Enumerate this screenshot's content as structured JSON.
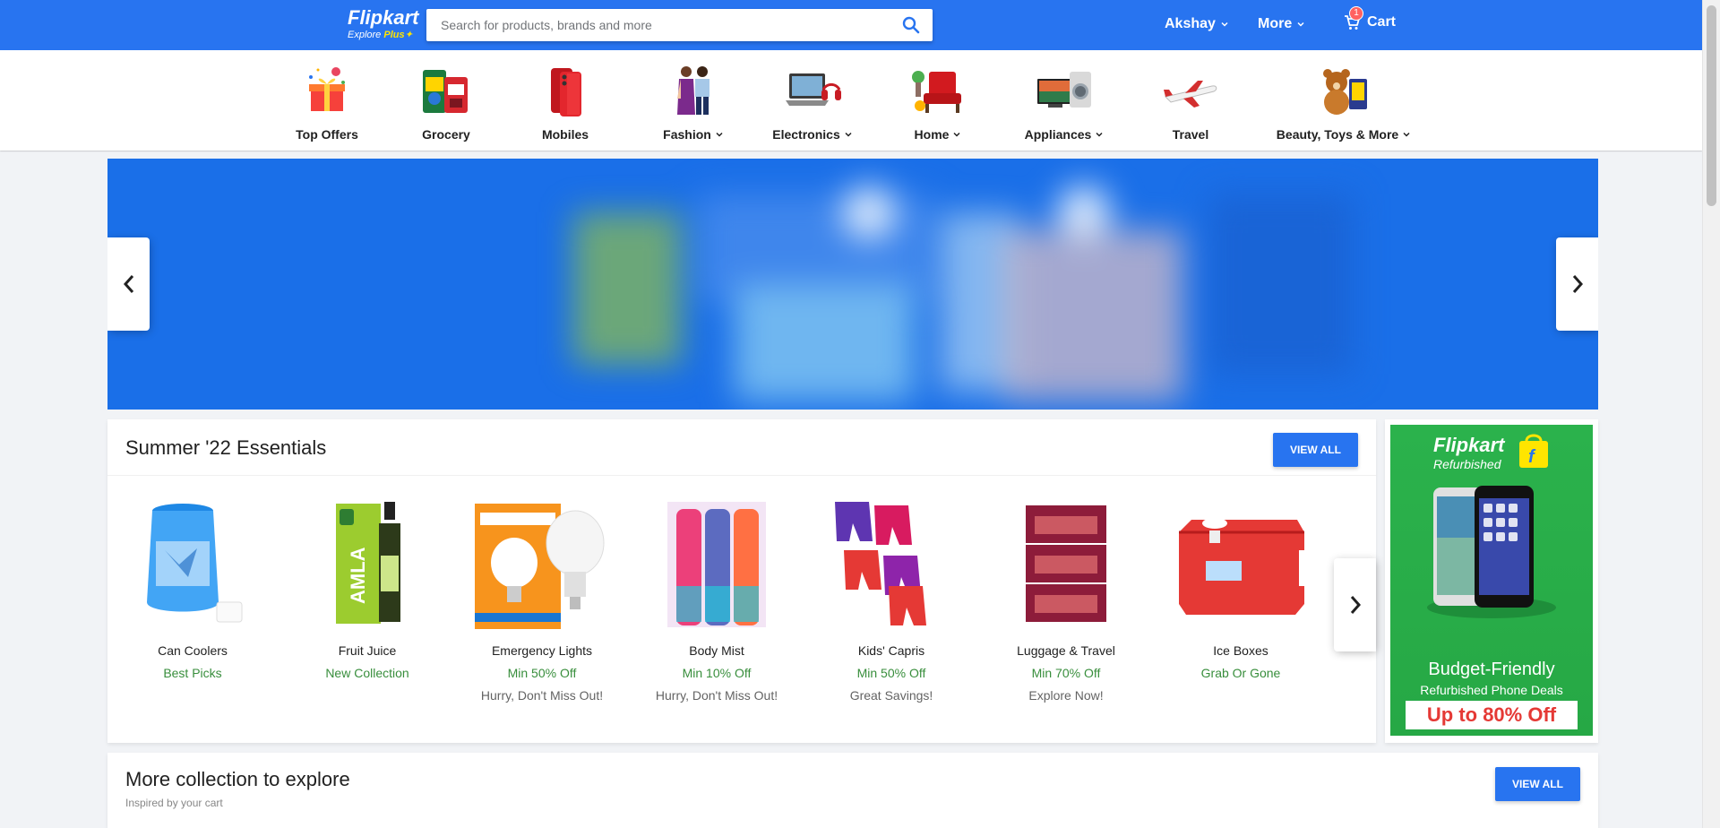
{
  "header": {
    "logo_text": "Flipkart",
    "logo_sub_prefix": "Explore ",
    "logo_sub_plus": "Plus",
    "search_placeholder": "Search for products, brands and more",
    "user_label": "Akshay",
    "more_label": "More",
    "cart_label": "Cart",
    "cart_count": "1",
    "brand_color": "#2874f0"
  },
  "categories": [
    {
      "label": "Top Offers",
      "dropdown": false,
      "icon": "gift-icon"
    },
    {
      "label": "Grocery",
      "dropdown": false,
      "icon": "grocery-icon"
    },
    {
      "label": "Mobiles",
      "dropdown": false,
      "icon": "mobile-icon"
    },
    {
      "label": "Fashion",
      "dropdown": true,
      "icon": "fashion-icon"
    },
    {
      "label": "Electronics",
      "dropdown": true,
      "icon": "laptop-icon"
    },
    {
      "label": "Home",
      "dropdown": true,
      "icon": "armchair-icon"
    },
    {
      "label": "Appliances",
      "dropdown": true,
      "icon": "appliance-icon"
    },
    {
      "label": "Travel",
      "dropdown": false,
      "icon": "airplane-icon"
    },
    {
      "label": "Beauty, Toys & More",
      "dropdown": true,
      "icon": "teddy-icon"
    }
  ],
  "summer": {
    "title": "Summer '22 Essentials",
    "view_all": "VIEW ALL",
    "products": [
      {
        "name": "Can Coolers",
        "offer": "Best Picks",
        "sub": ""
      },
      {
        "name": "Fruit Juice",
        "offer": "New Collection",
        "sub": ""
      },
      {
        "name": "Emergency Lights",
        "offer": "Min 50% Off",
        "sub": "Hurry, Don't Miss Out!"
      },
      {
        "name": "Body Mist",
        "offer": "Min 10% Off",
        "sub": "Hurry, Don't Miss Out!"
      },
      {
        "name": "Kids' Capris",
        "offer": "Min 50% Off",
        "sub": "Great Savings!"
      },
      {
        "name": "Luggage & Travel",
        "offer": "Min 70% Off",
        "sub": "Explore Now!"
      },
      {
        "name": "Ice Boxes",
        "offer": "Grab Or Gone",
        "sub": ""
      }
    ]
  },
  "ad": {
    "brand": "Flipkart",
    "brand_sub": "Refurbished",
    "headline": "Budget-Friendly",
    "subline": "Refurbished Phone Deals",
    "cta": "Up to 80% Off"
  },
  "more": {
    "title": "More collection to explore",
    "subtitle": "Inspired by your cart",
    "view_all": "VIEW ALL"
  }
}
